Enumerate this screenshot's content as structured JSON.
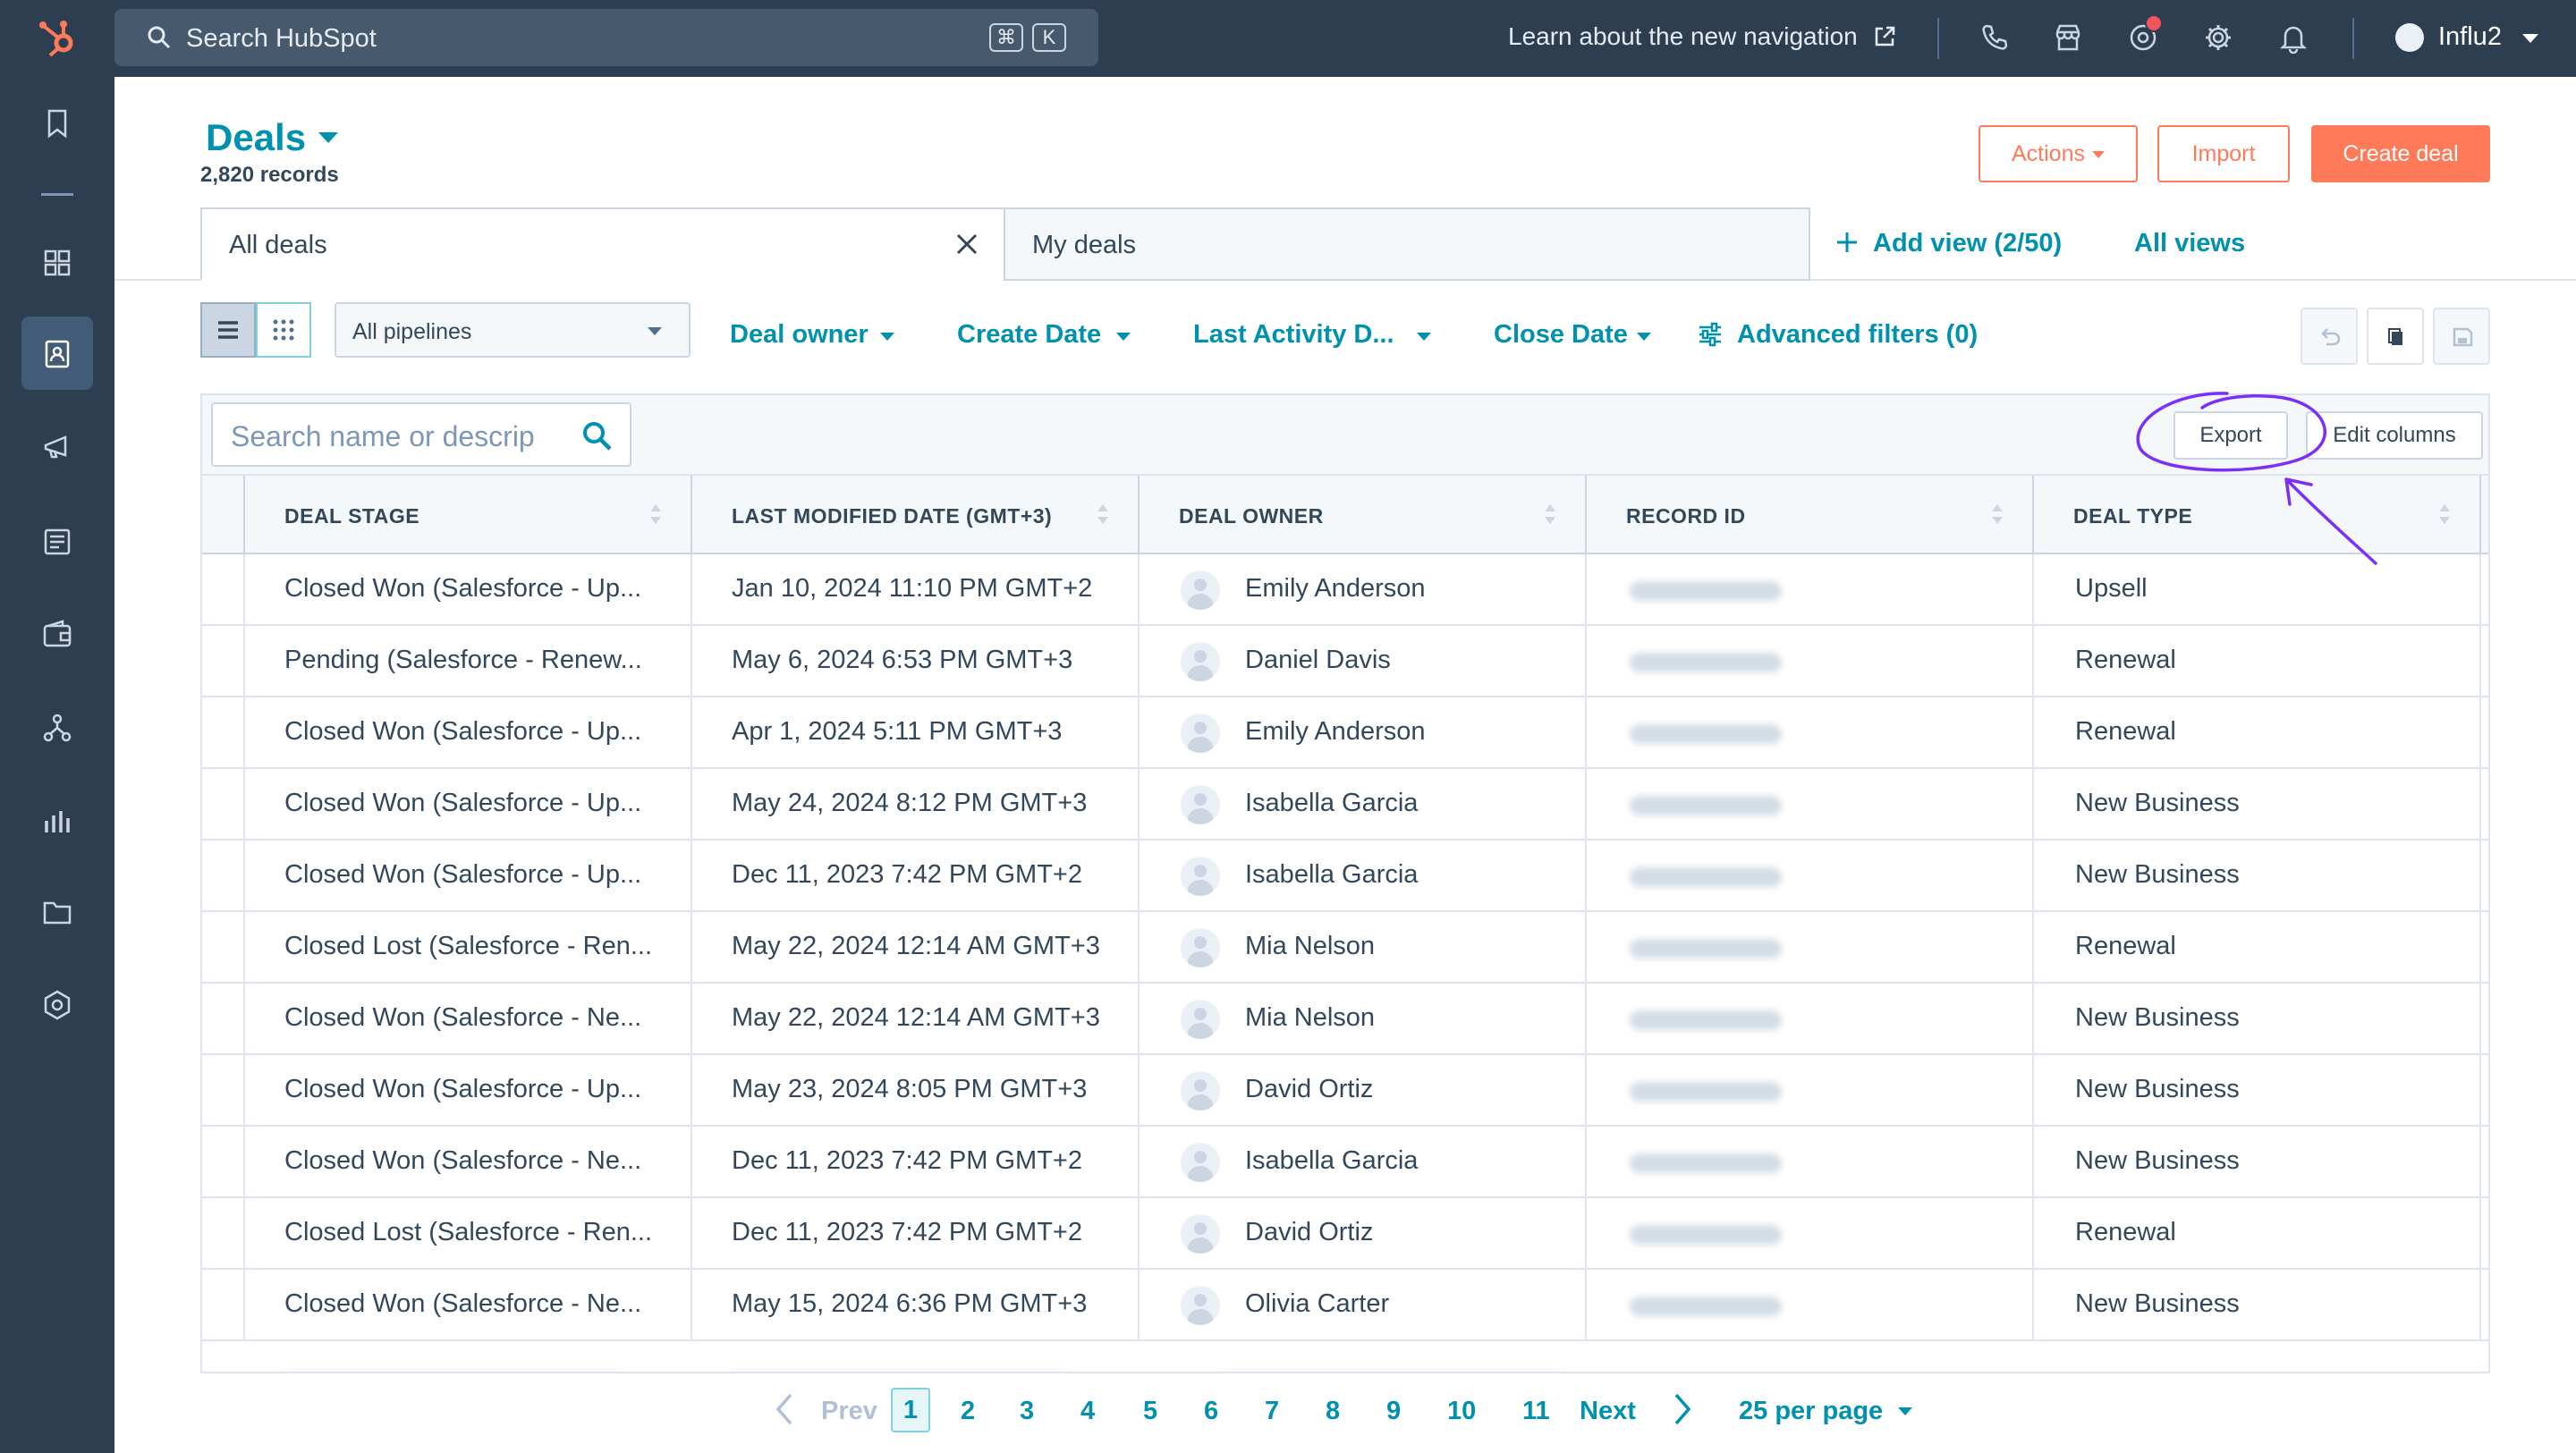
{
  "topbar": {
    "search_placeholder": "Search HubSpot",
    "shortcut_keys": [
      "⌘",
      "K"
    ],
    "learn_link": "Learn about the new navigation",
    "account_name": "Influ2"
  },
  "sidebar": {
    "icons": [
      "bookmark-icon",
      "apps-icon",
      "contacts-icon",
      "marketing-icon",
      "content-icon",
      "commerce-icon",
      "automation-icon",
      "reporting-icon",
      "library-icon",
      "settings-hex-icon"
    ]
  },
  "header": {
    "title": "Deals",
    "records": "2,820 records",
    "actions_label": "Actions",
    "import_label": "Import",
    "create_label": "Create deal"
  },
  "views": {
    "tabs": [
      {
        "label": "All deals",
        "active": true
      },
      {
        "label": "My deals",
        "active": false
      }
    ],
    "add_view": "Add view (2/50)",
    "all_views": "All views"
  },
  "filters": {
    "pipeline": "All pipelines",
    "deal_owner": "Deal owner",
    "create_date": "Create Date",
    "last_activity": "Last Activity D...",
    "close_date": "Close Date",
    "advanced": "Advanced filters (0)"
  },
  "table": {
    "search_placeholder": "Search name or descrip",
    "export_label": "Export",
    "edit_columns_label": "Edit columns",
    "columns": [
      "DEAL STAGE",
      "LAST MODIFIED DATE (GMT+3)",
      "DEAL OWNER",
      "RECORD ID",
      "DEAL TYPE"
    ],
    "rows": [
      {
        "stage": "Closed Won (Salesforce - Up...",
        "modified": "Jan 10, 2024 11:10 PM GMT+2",
        "owner": "Emily Anderson",
        "type": "Upsell"
      },
      {
        "stage": "Pending (Salesforce - Renew...",
        "modified": "May 6, 2024 6:53 PM GMT+3",
        "owner": "Daniel Davis",
        "type": "Renewal"
      },
      {
        "stage": "Closed Won (Salesforce - Up...",
        "modified": "Apr 1, 2024 5:11 PM GMT+3",
        "owner": "Emily Anderson",
        "type": "Renewal"
      },
      {
        "stage": "Closed Won (Salesforce - Up...",
        "modified": "May 24, 2024 8:12 PM GMT+3",
        "owner": "Isabella Garcia",
        "type": "New Business"
      },
      {
        "stage": "Closed Won (Salesforce - Up...",
        "modified": "Dec 11, 2023 7:42 PM GMT+2",
        "owner": "Isabella Garcia",
        "type": "New Business"
      },
      {
        "stage": "Closed Lost (Salesforce - Ren...",
        "modified": "May 22, 2024 12:14 AM GMT+3",
        "owner": "Mia Nelson",
        "type": "Renewal"
      },
      {
        "stage": "Closed Won (Salesforce - Ne...",
        "modified": "May 22, 2024 12:14 AM GMT+3",
        "owner": "Mia Nelson",
        "type": "New Business"
      },
      {
        "stage": "Closed Won (Salesforce - Up...",
        "modified": "May 23, 2024 8:05 PM GMT+3",
        "owner": "David Ortiz",
        "type": "New Business"
      },
      {
        "stage": "Closed Won (Salesforce - Ne...",
        "modified": "Dec 11, 2023 7:42 PM GMT+2",
        "owner": "Isabella Garcia",
        "type": "New Business"
      },
      {
        "stage": "Closed Lost (Salesforce - Ren...",
        "modified": "Dec 11, 2023 7:42 PM GMT+2",
        "owner": "David Ortiz",
        "type": "Renewal"
      },
      {
        "stage": "Closed Won (Salesforce - Ne...",
        "modified": "May 15, 2024 6:36 PM GMT+3",
        "owner": "Olivia Carter",
        "type": "New Business"
      }
    ]
  },
  "pagination": {
    "prev": "Prev",
    "pages": [
      "1",
      "2",
      "3",
      "4",
      "5",
      "6",
      "7",
      "8",
      "9",
      "10",
      "11"
    ],
    "current": "1",
    "next": "Next",
    "per_page": "25 per page"
  },
  "colors": {
    "nav": "#2d3e50",
    "link": "#0091ae",
    "accent": "#ff7a59",
    "annotation": "#7b2ff7"
  }
}
